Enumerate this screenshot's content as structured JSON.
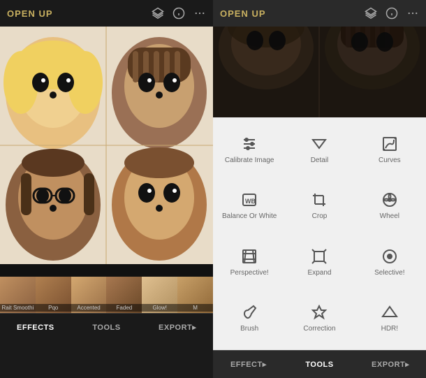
{
  "left": {
    "title": "OPEN UP",
    "header_icons": [
      "layers-icon",
      "info-icon",
      "more-icon"
    ],
    "thumbnails": [
      {
        "label": "Rait Smoothi"
      },
      {
        "label": "Pqo"
      },
      {
        "label": "Accented"
      },
      {
        "label": "Faded"
      },
      {
        "label": "Glow!"
      },
      {
        "label": "M"
      }
    ],
    "nav": [
      {
        "label": "Effects",
        "active": true
      },
      {
        "label": "TOOLS",
        "active": false
      },
      {
        "label": "EXPORT▸",
        "active": false
      }
    ]
  },
  "right": {
    "title": "OPEN UP",
    "header_icons": [
      "layers-icon",
      "info-icon",
      "more-icon"
    ],
    "tools": [
      {
        "label": "Calibrate Image",
        "icon": "sliders"
      },
      {
        "label": "Detail",
        "icon": "triangle-down"
      },
      {
        "label": "Curves",
        "icon": "curves"
      },
      {
        "label": "Balance Or White",
        "icon": "wb"
      },
      {
        "label": "Crop",
        "icon": "crop"
      },
      {
        "label": "Wheel",
        "icon": "wheel"
      },
      {
        "label": "Perspective!",
        "icon": "perspective"
      },
      {
        "label": "Expand",
        "icon": "expand"
      },
      {
        "label": "Selective!",
        "icon": "selective"
      },
      {
        "label": "Brush",
        "icon": "brush"
      },
      {
        "label": "Correction",
        "icon": "correction"
      },
      {
        "label": "HDR!",
        "icon": "hdr"
      }
    ],
    "nav": [
      {
        "label": "EFFECT▸",
        "active": false
      },
      {
        "label": "TOOLS",
        "active": true
      },
      {
        "label": "EXPORT▸",
        "active": false
      }
    ]
  },
  "colors": {
    "title": "#c8b060",
    "bg_dark": "#1a1a1a",
    "bg_light": "#f0f0f0",
    "icon": "#888",
    "tool_icon": "#555",
    "tool_label": "#666",
    "nav_active": "#fff",
    "nav_inactive": "#aaa"
  }
}
